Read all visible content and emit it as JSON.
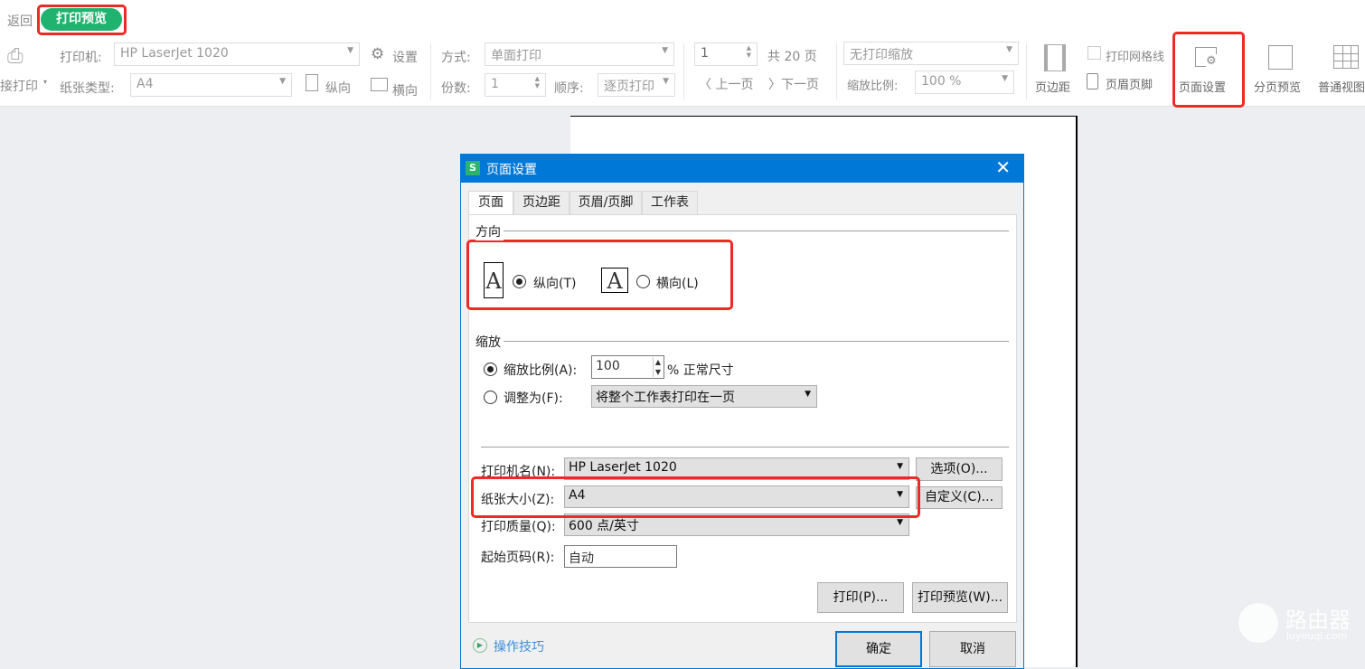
{
  "toolbar": {
    "back": "返回",
    "print_preview": "打印预览",
    "direct_print": "接打印",
    "printer_label": "打印机:",
    "printer_value": "HP LaserJet 1020",
    "settings": "设置",
    "paper_label": "纸张类型:",
    "paper_value": "A4",
    "portrait": "纵向",
    "landscape": "横向",
    "mode_label": "方式:",
    "mode_value": "单面打印",
    "copies_label": "份数:",
    "copies_value": "1",
    "order_label": "顺序:",
    "order_value": "逐页打印",
    "page_value": "1",
    "total_pages": "共 20 页",
    "prev_page": "上一页",
    "next_page": "下一页",
    "scale_mode": "无打印缩放",
    "scale_label": "缩放比例:",
    "scale_value": "100 %",
    "margins": "页边距",
    "gridlines": "打印网格线",
    "header_footer": "页眉页脚",
    "page_setup": "页面设置",
    "page_break_preview": "分页预览",
    "normal_view": "普通视图"
  },
  "dialog": {
    "app_icon": "S",
    "title": "页面设置",
    "tabs": [
      {
        "label": "页面"
      },
      {
        "label": "页边距"
      },
      {
        "label": "页眉/页脚"
      },
      {
        "label": "工作表"
      }
    ],
    "orientation": {
      "heading": "方向",
      "portrait": "纵向(T)",
      "landscape": "横向(L)",
      "selected": "portrait"
    },
    "scaling": {
      "heading": "缩放",
      "ratio_label": "缩放比例(A):",
      "ratio_value": "100",
      "ratio_suffix": "% 正常尺寸",
      "fit_label": "调整为(F):",
      "fit_value": "将整个工作表打印在一页"
    },
    "printer_name_label": "打印机名(N):",
    "printer_name_value": "HP LaserJet 1020",
    "options_button": "选项(O)...",
    "paper_size_label": "纸张大小(Z):",
    "paper_size_value": "A4",
    "custom_button": "自定义(C)...",
    "quality_label": "打印质量(Q):",
    "quality_value": "600 点/英寸",
    "start_page_label": "起始页码(R):",
    "start_page_value": "自动",
    "print_button": "打印(P)...",
    "preview_button": "打印预览(W)...",
    "tips": "操作技巧",
    "ok_button": "确定",
    "cancel_button": "取消"
  },
  "watermark": {
    "title": "路由器",
    "url": "luyouqi.com"
  },
  "colors": {
    "accent": "#0078d7",
    "green": "#1fb36f",
    "highlight": "#ee2a24"
  }
}
